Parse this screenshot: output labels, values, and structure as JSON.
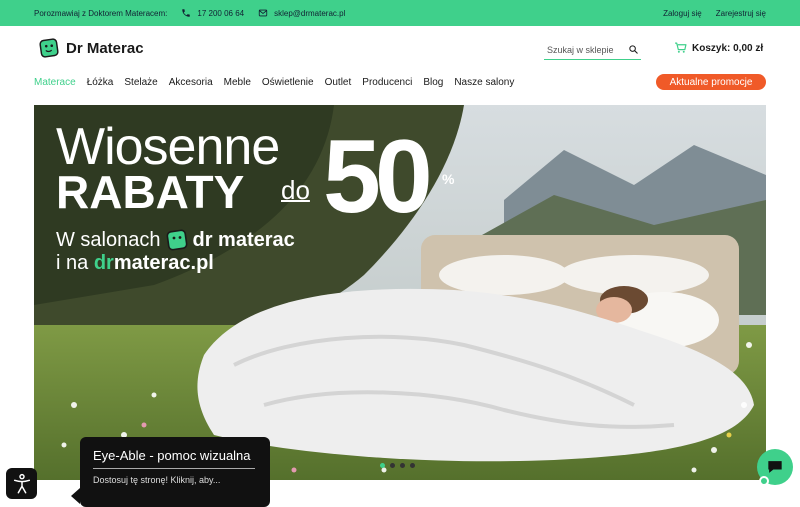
{
  "topbar": {
    "consult_text": "Porozmawiaj z Doktorem Materacem:",
    "phone": "17 200 06 64",
    "email": "sklep@drmaterac.pl",
    "login": "Zaloguj się",
    "register": "Zarejestruj się"
  },
  "header": {
    "logo_text": "Dr Materac",
    "search_placeholder": "Szukaj w sklepie",
    "cart_label": "Koszyk: 0,00 zł"
  },
  "nav": {
    "items": [
      "Materace",
      "Łóżka",
      "Stelaże",
      "Akcesoria",
      "Meble",
      "Oświetlenie",
      "Outlet",
      "Producenci",
      "Blog",
      "Nasze salony"
    ],
    "promo_label": "Aktualne promocje"
  },
  "hero": {
    "line1": "Wiosenne",
    "line2": "RABATY",
    "do": "do",
    "fifty": "50",
    "percent": "%",
    "line3_prefix": "W salonach",
    "line3_brand": "dr materac",
    "line4_prefix": "i na ",
    "line4_green": "dr",
    "line4_white": "materac.pl",
    "slides_total": 4,
    "slide_active": 1
  },
  "eye_able": {
    "title": "Eye-Able - pomoc wizualna",
    "subtitle": "Dostosuj tę stronę! Kliknij, aby..."
  },
  "colors": {
    "accent": "#3fd08b",
    "promo": "#f05a28"
  }
}
